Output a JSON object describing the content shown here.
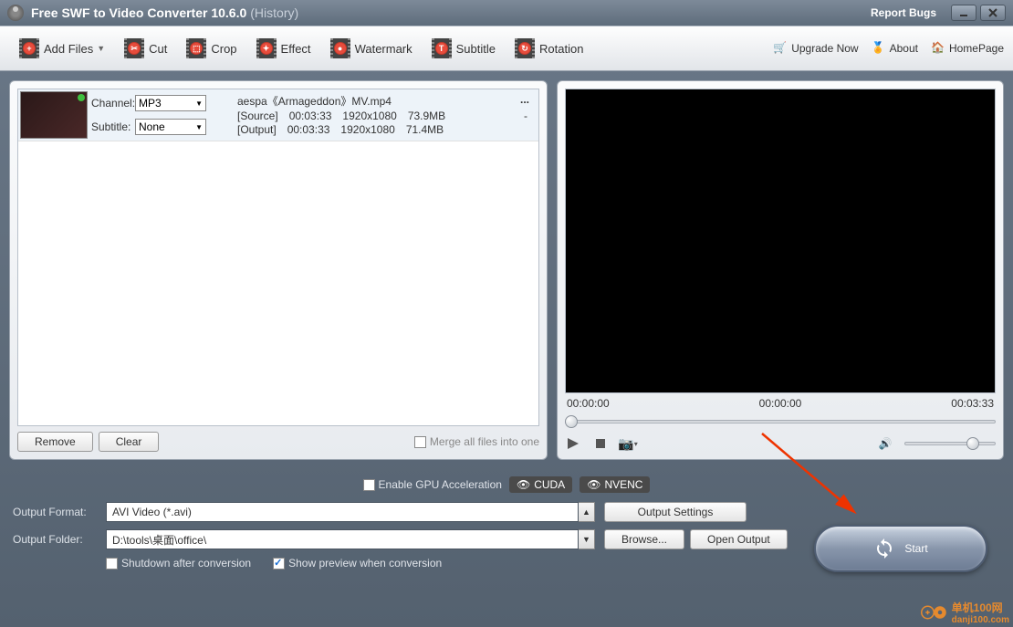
{
  "title": {
    "main": "Free SWF to Video Converter 10.6.0",
    "sub": "(History)",
    "report": "Report Bugs"
  },
  "toolbar": {
    "add": "Add Files",
    "cut": "Cut",
    "crop": "Crop",
    "effect": "Effect",
    "watermark": "Watermark",
    "subtitle": "Subtitle",
    "rotation": "Rotation",
    "upgrade": "Upgrade Now",
    "about": "About",
    "homepage": "HomePage"
  },
  "file": {
    "channel_label": "Channel:",
    "channel_value": "MP3",
    "subtitle_label": "Subtitle:",
    "subtitle_value": "None",
    "name": "aespa《Armageddon》MV.mp4",
    "source_label": "[Source]",
    "source_dur": "00:03:33",
    "source_res": "1920x1080",
    "source_size": "73.9MB",
    "output_label": "[Output]",
    "output_dur": "00:03:33",
    "output_res": "1920x1080",
    "output_size": "71.4MB",
    "more": "...",
    "dash": "-"
  },
  "list_footer": {
    "remove": "Remove",
    "clear": "Clear",
    "merge": "Merge all files into one"
  },
  "preview": {
    "t_start": "00:00:00",
    "t_cur": "00:00:00",
    "t_end": "00:03:33"
  },
  "gpu": {
    "label": "Enable GPU Acceleration",
    "cuda": "CUDA",
    "nvenc": "NVENC"
  },
  "output": {
    "format_label": "Output Format:",
    "format_value": "AVI Video (*.avi)",
    "folder_label": "Output Folder:",
    "folder_value": "D:\\tools\\桌面\\office\\",
    "settings": "Output Settings",
    "browse": "Browse...",
    "open": "Open Output"
  },
  "checks": {
    "shutdown": "Shutdown after conversion",
    "preview": "Show preview when conversion"
  },
  "start": "Start",
  "watermark_site": {
    "name": "单机100网",
    "url": "danji100.com"
  }
}
